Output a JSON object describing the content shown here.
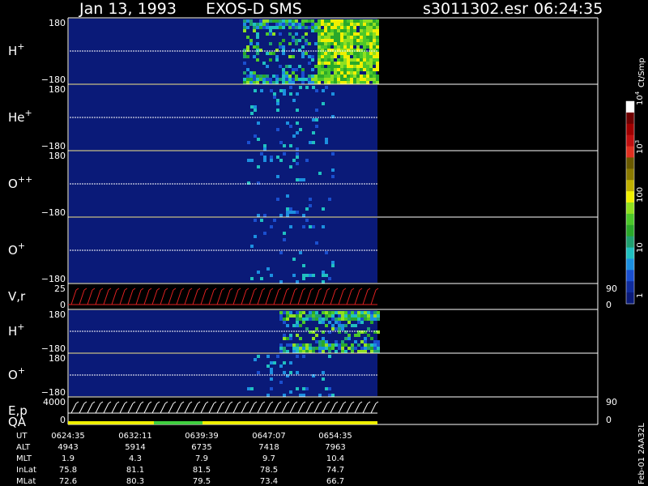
{
  "header": {
    "date": "Jan 13, 1993",
    "instrument": "EXOS-D SMS",
    "file": "s3011302.esr",
    "time": "06:24:35"
  },
  "colors": {
    "background": "#000000",
    "panel_fill": "#0a1a78",
    "trace": "#ffffff",
    "vector": "#e02020",
    "qa_yellow": "#f0f000",
    "qa_green": "#40d040"
  },
  "colorbar": {
    "unit_label": "Ct/Smp",
    "tick_labels": [
      "1",
      "10",
      "100",
      "10",
      "10"
    ],
    "tick_exponents": [
      "",
      "",
      "",
      "3",
      "4"
    ],
    "colors": [
      "#0a1a78",
      "#102c9c",
      "#1a4fcf",
      "#1c8fe0",
      "#20c0c0",
      "#20a070",
      "#2aa82a",
      "#4cc82a",
      "#90e020",
      "#f0f000",
      "#c0b000",
      "#8a7a00",
      "#6a5a00",
      "#e03020",
      "#c01010",
      "#a00000",
      "#700000",
      "#ffffff"
    ]
  },
  "footer_code": "Feb-01 2AA32L",
  "chart_data": {
    "type": "heatmap",
    "panels": [
      {
        "name": "H",
        "sup": "+",
        "ymax_label": "180",
        "ymin_label": "−180",
        "ymin": -180,
        "ymax": 180
      },
      {
        "name": "He",
        "sup": "+",
        "ymax_label": "180",
        "ymin_label": "−180",
        "ymin": -180,
        "ymax": 180
      },
      {
        "name": "O",
        "sup": "++",
        "ymax_label": "180",
        "ymin_label": "−180",
        "ymin": -180,
        "ymax": 180
      },
      {
        "name": "O",
        "sup": "+",
        "ymax_label": "",
        "ymin_label": "−180",
        "ymin": -180,
        "ymax": 180
      },
      {
        "name": "V,r",
        "sup": "",
        "ymax_label": "25",
        "ymin_label": "0",
        "right_top": "90",
        "right_bottom": "0"
      },
      {
        "name": "H",
        "sup": "+",
        "ymax_label": "180",
        "ymin_label": "−180",
        "ymin": -180,
        "ymax": 180
      },
      {
        "name": "O",
        "sup": "+",
        "ymax_label": "180",
        "ymin_label": "−180",
        "ymin": -180,
        "ymax": 180
      },
      {
        "name": "E,p",
        "sup": "",
        "ymax_label": "4000",
        "ymin_label": "0",
        "right_top": "90",
        "right_bottom": "0",
        "extra_label": "QA"
      }
    ],
    "time_axis": {
      "rows": [
        {
          "label": "UT",
          "values": [
            "0624:35",
            "0632:11",
            "0639:39",
            "0647:07",
            "0654:35"
          ]
        },
        {
          "label": "ALT",
          "values": [
            "4943",
            "5914",
            "6735",
            "7418",
            "7963"
          ]
        },
        {
          "label": "MLT",
          "values": [
            "1.9",
            "4.3",
            "7.9",
            "9.7",
            "10.4"
          ]
        },
        {
          "label": "InLat",
          "values": [
            "75.8",
            "81.1",
            "81.5",
            "78.5",
            "74.7"
          ]
        },
        {
          "label": "MLat",
          "values": [
            "72.6",
            "80.3",
            "79.5",
            "73.4",
            "66.7"
          ]
        }
      ]
    }
  }
}
